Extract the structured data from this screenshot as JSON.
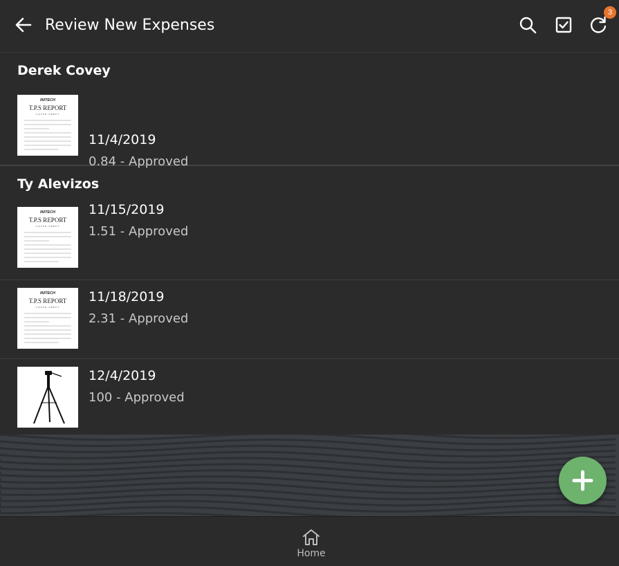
{
  "header": {
    "title": "Review New Expenses",
    "back_icon": "arrow-left-icon",
    "search_icon": "search-icon",
    "select_icon": "checkbox-icon",
    "refresh_icon": "refresh-icon",
    "badge_count": "3",
    "badge_color": "#e8752d"
  },
  "groups": [
    {
      "name": "Derek Covey",
      "items": [
        {
          "date": "11/4/2019",
          "status": "0.84 - Approved",
          "thumb": "tps-report"
        }
      ]
    },
    {
      "name": "Ty Alevizos",
      "items": [
        {
          "date": "11/15/2019",
          "status": "1.51 - Approved",
          "thumb": "tps-report"
        },
        {
          "date": "11/18/2019",
          "status": "2.31 - Approved",
          "thumb": "tps-report"
        },
        {
          "date": "12/4/2019",
          "status": "100 - Approved",
          "thumb": "tripod"
        }
      ]
    }
  ],
  "tps_thumb": {
    "brand": "INITECH",
    "title": "T.P.S REPORT",
    "subtitle": "COVER SHEET"
  },
  "fab": {
    "icon": "plus-icon",
    "color": "#6db36d"
  },
  "bottom_nav": {
    "home_label": "Home",
    "home_icon": "home-icon"
  }
}
